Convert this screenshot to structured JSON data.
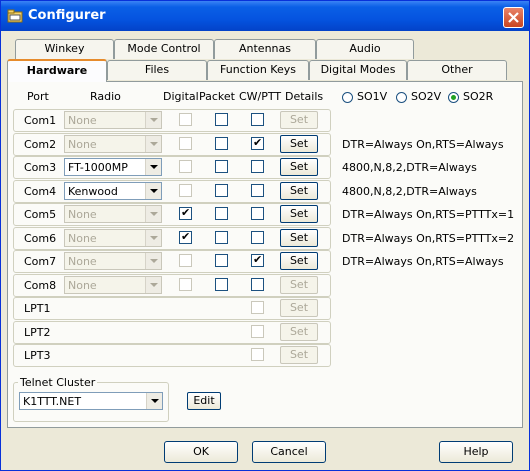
{
  "window": {
    "title": "Configurer"
  },
  "tabs_back": [
    {
      "label": "Winkey"
    },
    {
      "label": "Mode Control"
    },
    {
      "label": "Antennas"
    },
    {
      "label": "Audio"
    }
  ],
  "tabs_front": [
    {
      "label": "Hardware",
      "active": true
    },
    {
      "label": "Files"
    },
    {
      "label": "Function Keys"
    },
    {
      "label": "Digital Modes"
    },
    {
      "label": "Other"
    }
  ],
  "columns": {
    "port": "Port",
    "radio": "Radio",
    "digital": "Digital",
    "packet": "Packet",
    "cwptt": "CW/PTT",
    "details": "Details"
  },
  "rows": [
    {
      "port": "Com1",
      "radio": "None",
      "radio_enabled": false,
      "digital": false,
      "digital_enabled": false,
      "packet": false,
      "cwptt": false,
      "set": "Set",
      "set_enabled": false,
      "details": ""
    },
    {
      "port": "Com2",
      "radio": "None",
      "radio_enabled": false,
      "digital": false,
      "digital_enabled": false,
      "packet": false,
      "cwptt": true,
      "set": "Set",
      "set_enabled": true,
      "details": "DTR=Always On,RTS=Always"
    },
    {
      "port": "Com3",
      "radio": "FT-1000MP",
      "radio_enabled": true,
      "digital": false,
      "digital_enabled": false,
      "packet": false,
      "cwptt": false,
      "set": "Set",
      "set_enabled": true,
      "details": "4800,N,8,2,DTR=Always"
    },
    {
      "port": "Com4",
      "radio": "Kenwood",
      "radio_enabled": true,
      "digital": false,
      "digital_enabled": false,
      "packet": false,
      "cwptt": false,
      "set": "Set",
      "set_enabled": true,
      "details": "4800,N,8,2,DTR=Always"
    },
    {
      "port": "Com5",
      "radio": "None",
      "radio_enabled": false,
      "digital": true,
      "digital_enabled": true,
      "packet": false,
      "cwptt": false,
      "set": "Set",
      "set_enabled": true,
      "details": "DTR=Always On,RTS=PTTTx=1"
    },
    {
      "port": "Com6",
      "radio": "None",
      "radio_enabled": false,
      "digital": true,
      "digital_enabled": true,
      "packet": false,
      "cwptt": false,
      "set": "Set",
      "set_enabled": true,
      "details": "DTR=Always On,RTS=PTTTx=2"
    },
    {
      "port": "Com7",
      "radio": "None",
      "radio_enabled": false,
      "digital": false,
      "digital_enabled": false,
      "packet": false,
      "cwptt": true,
      "set": "Set",
      "set_enabled": true,
      "details": "DTR=Always On,RTS=Always"
    },
    {
      "port": "Com8",
      "radio": "None",
      "radio_enabled": false,
      "digital": false,
      "digital_enabled": false,
      "packet": false,
      "cwptt": false,
      "set": "Set",
      "set_enabled": false,
      "details": ""
    },
    {
      "port": "LPT1",
      "cwptt": false,
      "set": "Set",
      "set_enabled": false
    },
    {
      "port": "LPT2",
      "cwptt": false,
      "set": "Set",
      "set_enabled": false
    },
    {
      "port": "LPT3",
      "cwptt": false,
      "set": "Set",
      "set_enabled": false
    }
  ],
  "mode_radios": [
    {
      "label": "SO1V",
      "selected": false
    },
    {
      "label": "SO2V",
      "selected": false
    },
    {
      "label": "SO2R",
      "selected": true
    }
  ],
  "telnet": {
    "label": "Telnet Cluster",
    "value": "K1TTT.NET",
    "edit_label": "Edit"
  },
  "footer": {
    "ok": "OK",
    "cancel": "Cancel",
    "help": "Help"
  },
  "icons": {
    "title": "folder-config-icon",
    "close": "close-icon",
    "dropdown": "chevron-down-icon",
    "check": "check-icon"
  }
}
